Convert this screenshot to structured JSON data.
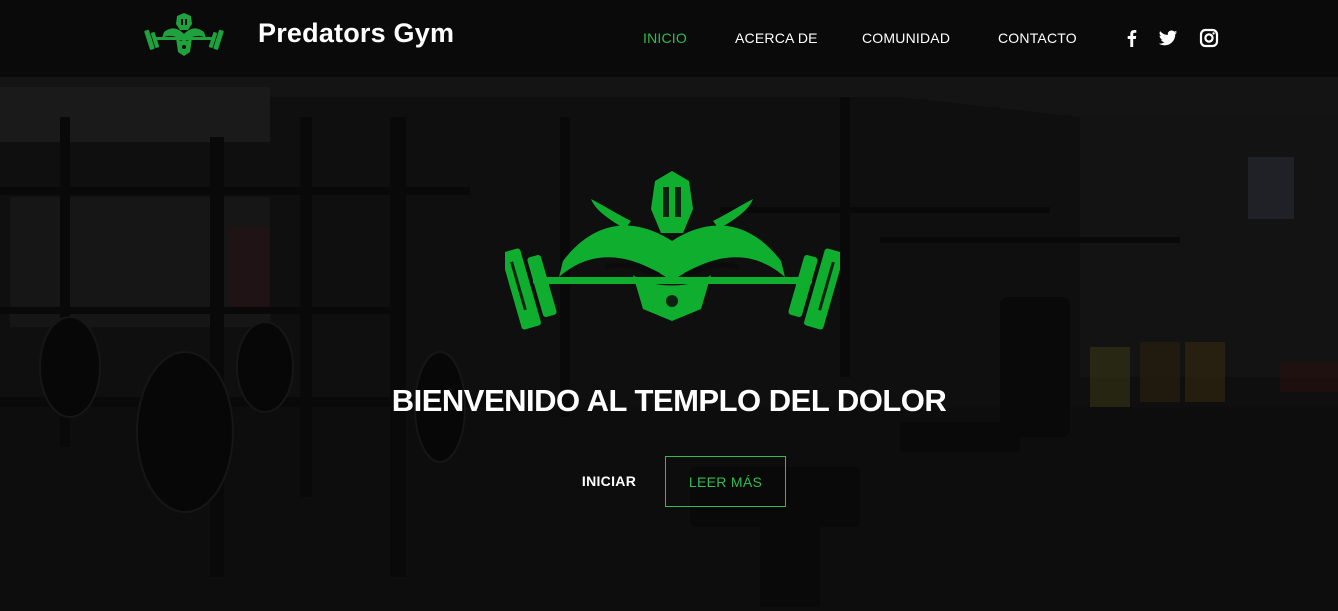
{
  "header": {
    "brand_name": "Predators Gym",
    "nav": [
      {
        "label": "INICIO",
        "active": true
      },
      {
        "label": "ACERCA DE",
        "active": false
      },
      {
        "label": "COMUNIDAD",
        "active": false
      },
      {
        "label": "CONTACTO",
        "active": false
      }
    ],
    "social": [
      {
        "icon": "facebook-icon"
      },
      {
        "icon": "twitter-icon"
      },
      {
        "icon": "instagram-icon"
      }
    ]
  },
  "hero": {
    "title": "BIENVENIDO AL TEMPLO DEL DOLOR",
    "primary_button": "INICIAR",
    "secondary_button": "LEER MÁS"
  },
  "colors": {
    "accent": "#2ebd4e",
    "header_bg": "#0a0a0a",
    "text": "#ffffff"
  }
}
